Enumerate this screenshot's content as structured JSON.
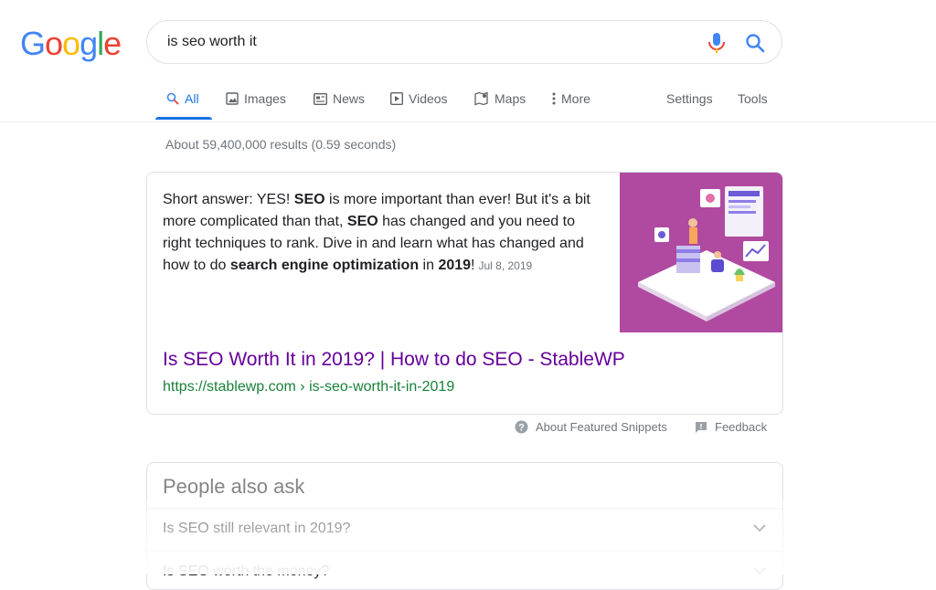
{
  "logo": {
    "letters": [
      "G",
      "o",
      "o",
      "g",
      "l",
      "e"
    ],
    "colors": [
      "#4285F4",
      "#EA4335",
      "#FBBC05",
      "#4285F4",
      "#34A853",
      "#EA4335"
    ]
  },
  "search": {
    "value": "is seo worth it"
  },
  "tabs": {
    "all": "All",
    "images": "Images",
    "news": "News",
    "videos": "Videos",
    "maps": "Maps",
    "more": "More",
    "settings": "Settings",
    "tools": "Tools"
  },
  "stats": "About 59,400,000 results (0.59 seconds)",
  "snippet": {
    "t1": "Short answer: YES! ",
    "b1": "SEO",
    "t2": " is more important than ever! But it's a bit more complicated than that, ",
    "b2": "SEO",
    "t3": " has changed and you need to right techniques to rank. Dive in and learn what has changed and how to do ",
    "b3": "search engine optimization",
    "t4": " in ",
    "b4": "2019",
    "t5": "!",
    "date": "Jul 8, 2019",
    "image_bg": "#b04aa0"
  },
  "result": {
    "title": "Is SEO Worth It in 2019? | How to do SEO - StableWP",
    "url": "https://stablewp.com › is-seo-worth-it-in-2019"
  },
  "footer": {
    "about": "About Featured Snippets",
    "feedback": "Feedback"
  },
  "paa": {
    "title": "People also ask",
    "questions": [
      "Is SEO still relevant in 2019?",
      "Is SEO worth the money?"
    ]
  }
}
